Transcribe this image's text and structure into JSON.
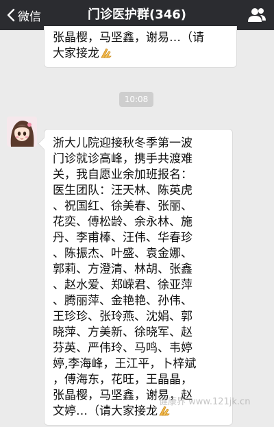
{
  "navbar": {
    "back_label": "微信",
    "title": "门诊医护群(346)",
    "back_icon": "chevron-left-icon",
    "group_icon": "group-members-icon"
  },
  "messages": [
    {
      "lines": [
        "张晶樱，马坚鑫，谢易…（请",
        "大家接龙"
      ],
      "emoji": "praying-hands-emoji"
    },
    {
      "time": "10:08"
    },
    {
      "avatar": "cartoon-girl-avatar",
      "lines": [
        "浙大儿院迎接秋冬季第一波",
        "门诊就诊高峰，携手共渡难",
        "关，我自愿业余加班报名：",
        "医生团队：汪天林、陈英虎",
        "、祝国红、徐美春、张丽、",
        "花奕、傅松龄、余永林、施",
        "丹、李甫棒、汪伟、华春珍",
        "、陈振杰、叶盛、袁金娜、",
        "郭莉、方澄清、林胡、张鑫",
        "、赵水爱、郑嵘君、徐亚萍",
        "、腾丽萍、金艳艳、孙伟、",
        "王珍珍、张玲燕、沈娟、郭",
        "晓萍、方美新、徐晓军、赵",
        "芬英、严伟玲、马鸣、韦婷",
        "婷,李海峰，王江平，卜梓斌",
        "，傅海东，花旺，王晶晶，",
        "张晶樱，马坚鑫，谢易，赵",
        "文婷…（请大家接龙"
      ],
      "emoji": "praying-hands-emoji"
    }
  ],
  "watermark": "健康界 www.121jk.cn",
  "colors": {
    "navbar": "#2b2c30",
    "background": "#ebebeb",
    "bubble": "#ffffff",
    "time_badge": "#cecece"
  }
}
